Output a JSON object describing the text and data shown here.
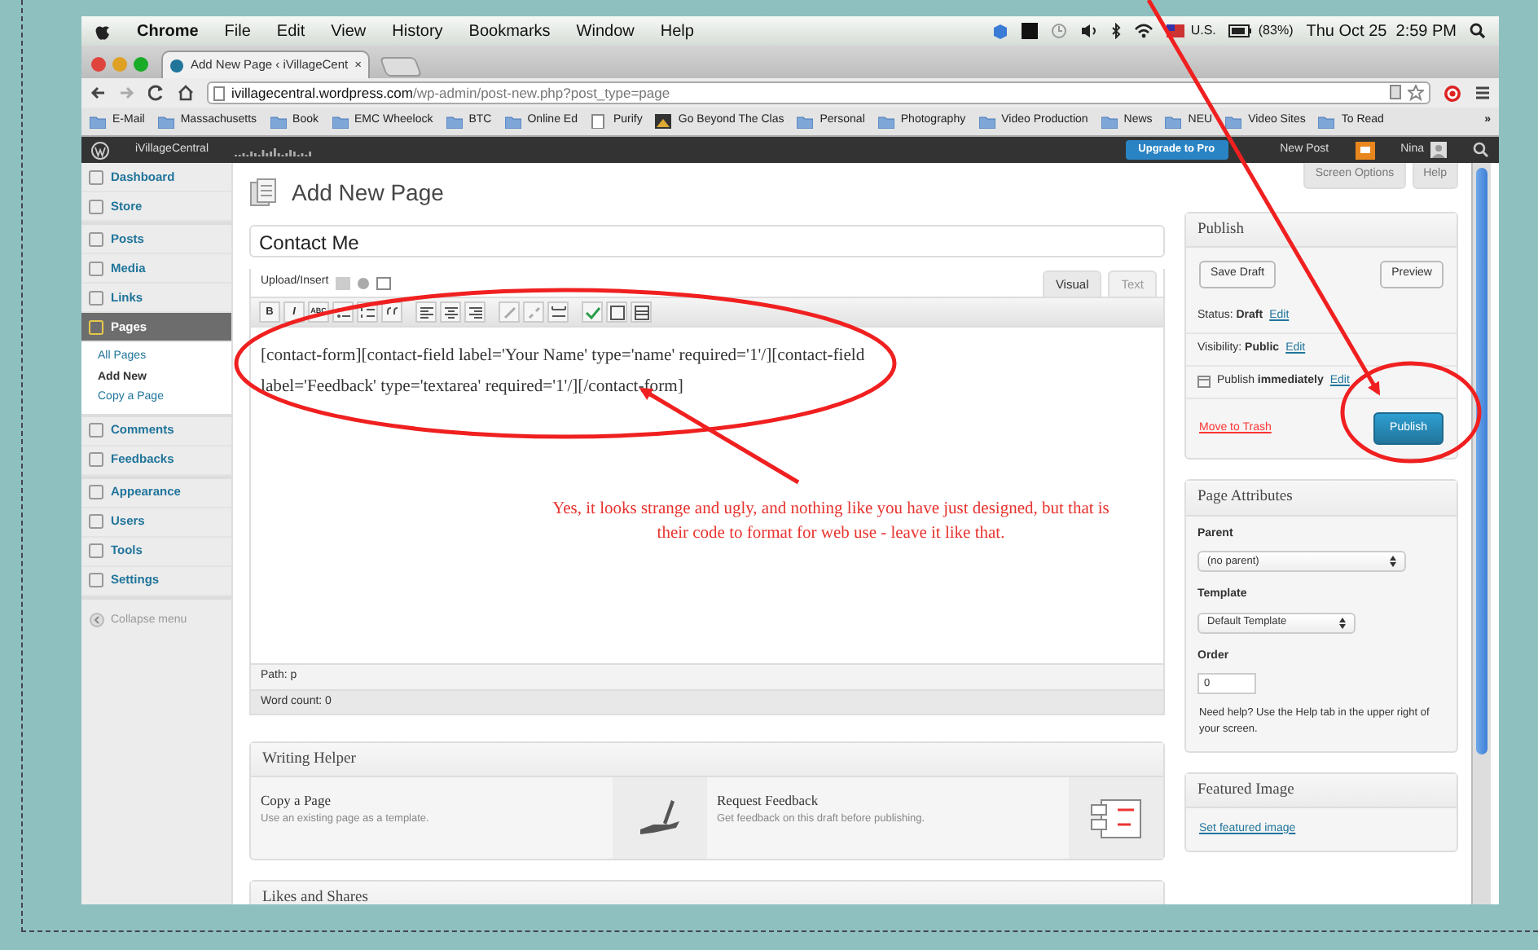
{
  "menubar": {
    "app": "Chrome",
    "menus": [
      "File",
      "Edit",
      "View",
      "History",
      "Bookmarks",
      "Window",
      "Help"
    ],
    "input_source": "U.S.",
    "battery": "(83%)",
    "clock": "Thu Oct 25  2:59 PM"
  },
  "browser": {
    "tab": {
      "title": "Add New Page ‹ iVillageCent",
      "close": "×"
    },
    "url": {
      "host": "ivillagecentral.wordpress.com",
      "path": "/wp-admin/post-new.php?post_type=page"
    },
    "bookmarks": [
      {
        "kind": "folder",
        "label": "E-Mail"
      },
      {
        "kind": "folder",
        "label": "Massachusetts"
      },
      {
        "kind": "folder",
        "label": "Book"
      },
      {
        "kind": "folder",
        "label": "EMC Wheelock"
      },
      {
        "kind": "folder",
        "label": "BTC"
      },
      {
        "kind": "folder",
        "label": "Online Ed"
      },
      {
        "kind": "page",
        "label": "Purify"
      },
      {
        "kind": "image",
        "label": "Go Beyond The Clas"
      },
      {
        "kind": "folder",
        "label": "Personal"
      },
      {
        "kind": "folder",
        "label": "Photography"
      },
      {
        "kind": "folder",
        "label": "Video Production"
      },
      {
        "kind": "folder",
        "label": "News"
      },
      {
        "kind": "folder",
        "label": "NEU"
      },
      {
        "kind": "folder",
        "label": "Video Sites"
      },
      {
        "kind": "folder",
        "label": "To Read"
      }
    ],
    "more": "»"
  },
  "admin_bar": {
    "site": "iVillageCentral",
    "upgrade": "Upgrade to Pro",
    "new_post": "New Post",
    "user": "Nina"
  },
  "sidebar": {
    "groups": [
      [
        {
          "label": "Dashboard",
          "selected": false
        },
        {
          "label": "Store",
          "selected": false
        }
      ],
      [
        {
          "label": "Posts",
          "selected": false
        },
        {
          "label": "Media",
          "selected": false
        },
        {
          "label": "Links",
          "selected": false
        },
        {
          "label": "Pages",
          "selected": true,
          "children": [
            {
              "label": "All Pages",
              "selected": false
            },
            {
              "label": "Add New",
              "selected": true
            },
            {
              "label": "Copy a Page",
              "selected": false
            }
          ]
        }
      ],
      [
        {
          "label": "Comments",
          "selected": false
        },
        {
          "label": "Feedbacks",
          "selected": false
        }
      ],
      [
        {
          "label": "Appearance",
          "selected": false
        },
        {
          "label": "Users",
          "selected": false
        },
        {
          "label": "Tools",
          "selected": false
        },
        {
          "label": "Settings",
          "selected": false
        }
      ]
    ],
    "collapse": "Collapse menu"
  },
  "header": {
    "title": "Add New Page",
    "screen_options": "Screen Options",
    "help": "Help"
  },
  "editor": {
    "post_title": "Contact Me",
    "upload_label": "Upload/Insert",
    "tabs": [
      {
        "label": "Visual",
        "selected": true
      },
      {
        "label": "Text",
        "selected": false
      }
    ],
    "toolbar_text": [
      "B",
      "I",
      "ABC"
    ],
    "content": "[contact-form][contact-field label='Your Name' type='name' required='1'/][contact-field label='Feedback' type='textarea' required='1'/][/contact-form]",
    "path": "Path: p",
    "word_count": "Word count: 0"
  },
  "writing_helper": {
    "title": "Writing Helper",
    "items": [
      {
        "title": "Copy a Page",
        "text": "Use an existing page as a template.",
        "kind": "hand"
      },
      {
        "title": "Request Feedback",
        "text": "Get feedback on this draft before publishing.",
        "kind": "document"
      }
    ]
  },
  "likes": {
    "title": "Likes and Shares"
  },
  "publish": {
    "title": "Publish",
    "save_draft": "Save Draft",
    "preview": "Preview",
    "rows": [
      {
        "text": "Status: **Draft**",
        "link": "Edit",
        "kind": "plain"
      },
      {
        "text": "Visibility: **Public**",
        "link": "Edit",
        "kind": "plain"
      },
      {
        "text": "Publish **immediately**",
        "link": "Edit",
        "kind": "calendar"
      }
    ],
    "trash": "Move to Trash",
    "button": "Publish"
  },
  "page_attributes": {
    "title": "Page Attributes",
    "parent_label": "Parent",
    "parent": "(no parent)",
    "template_label": "Template",
    "template": "Default Template",
    "order_label": "Order",
    "order": "0",
    "help": "Need help? Use the Help tab in the upper right of your screen."
  },
  "featured_image": {
    "title": "Featured Image",
    "link": "Set featured image"
  },
  "annotation": {
    "text": "Yes, it looks strange and ugly, and nothing like you have just designed, but that is their code to format for web use - leave it like that."
  }
}
